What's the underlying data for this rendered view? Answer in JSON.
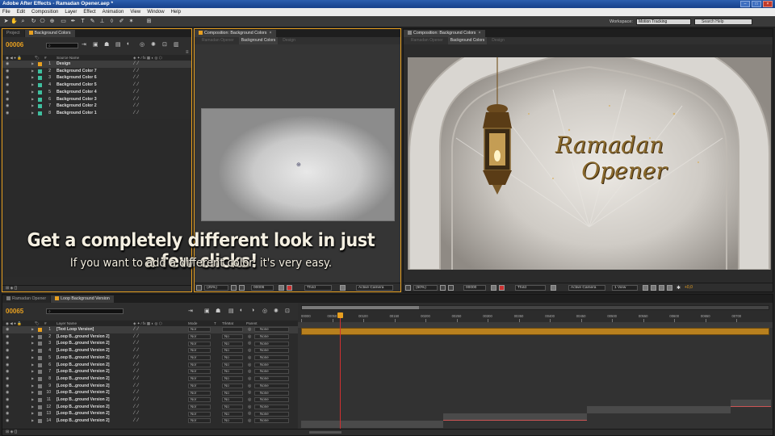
{
  "app": {
    "title": "Adobe After Effects - Ramadan Opener.aep *",
    "menu": [
      "File",
      "Edit",
      "Composition",
      "Layer",
      "Effect",
      "Animation",
      "View",
      "Window",
      "Help"
    ],
    "workspace_label": "Workspace:",
    "workspace_value": "Motion Tracking",
    "search_placeholder": "Search Help"
  },
  "left_panel": {
    "tabs": [
      "Project",
      "Background Colors"
    ],
    "timecode": "00006",
    "col_header": "Source Name",
    "layers": [
      {
        "idx": "1",
        "name": "Design",
        "color": "#e8a020"
      },
      {
        "idx": "2",
        "name": "Background Color 7",
        "color": "#3fbf9f"
      },
      {
        "idx": "3",
        "name": "Background Color 6",
        "color": "#3fbf9f"
      },
      {
        "idx": "4",
        "name": "Background Color 5",
        "color": "#3fbf9f"
      },
      {
        "idx": "5",
        "name": "Background Color 4",
        "color": "#3fbf9f"
      },
      {
        "idx": "6",
        "name": "Background Color 3",
        "color": "#3fbf9f"
      },
      {
        "idx": "7",
        "name": "Background Color 2",
        "color": "#3fbf9f"
      },
      {
        "idx": "8",
        "name": "Background Color 1",
        "color": "#3fbf9f"
      }
    ]
  },
  "center_panel": {
    "tab": "Composition: Background Colors",
    "subtabs": [
      "Ramadan Opener",
      "Background Colors",
      "Design"
    ],
    "zoom": "(25%)",
    "timecode": "00006",
    "resolution": "Third",
    "camera": "Active Camera"
  },
  "right_panel": {
    "tab": "Composition: Background Colors",
    "subtabs": [
      "Ramadan Opener",
      "Background Colors",
      "Design"
    ],
    "zoom": "(50%)",
    "timecode": "00000",
    "resolution": "Third",
    "camera": "Active Camera",
    "views": "1 View",
    "exposure": "+0,0",
    "logo_line1": "Ramadan",
    "logo_line2": "Opener"
  },
  "captions": {
    "main": "Get a completely different look in just a few clicks!",
    "sub": "If you want to add a different color, it's very easy."
  },
  "timeline": {
    "tabs": [
      "Ramadan Opener",
      "Loop Background Version"
    ],
    "timecode": "00065",
    "headers": {
      "layer_name": "Layer Name",
      "mode": "Mode",
      "t": "T",
      "trkmat": "TrkMat",
      "parent": "Parent"
    },
    "ruler": [
      "00000",
      "00050",
      "00100",
      "00150",
      "00200",
      "00250",
      "00300",
      "00350",
      "00400",
      "00450",
      "00500",
      "00550",
      "00600",
      "00650",
      "00700"
    ],
    "layers": [
      {
        "idx": "1",
        "name": "[Text Loop Version]",
        "color": "#e8a020",
        "mode": "Nor",
        "trkmat": "",
        "parent": "None"
      },
      {
        "idx": "2",
        "name": "[Loop B...ground Version 2]",
        "color": "#7a7a7a",
        "mode": "Nor",
        "trkmat": "No",
        "parent": "None"
      },
      {
        "idx": "3",
        "name": "[Loop B...ground Version 2]",
        "color": "#7a7a7a",
        "mode": "Nor",
        "trkmat": "No",
        "parent": "None"
      },
      {
        "idx": "4",
        "name": "[Loop B...ground Version 2]",
        "color": "#7a7a7a",
        "mode": "Nor",
        "trkmat": "No",
        "parent": "None"
      },
      {
        "idx": "5",
        "name": "[Loop B...ground Version 2]",
        "color": "#7a7a7a",
        "mode": "Nor",
        "trkmat": "No",
        "parent": "None"
      },
      {
        "idx": "6",
        "name": "[Loop B...ground Version 2]",
        "color": "#7a7a7a",
        "mode": "Nor",
        "trkmat": "No",
        "parent": "None"
      },
      {
        "idx": "7",
        "name": "[Loop B...ground Version 2]",
        "color": "#7a7a7a",
        "mode": "Nor",
        "trkmat": "No",
        "parent": "None"
      },
      {
        "idx": "8",
        "name": "[Loop B...ground Version 2]",
        "color": "#7a7a7a",
        "mode": "Nor",
        "trkmat": "No",
        "parent": "None"
      },
      {
        "idx": "9",
        "name": "[Loop B...ground Version 2]",
        "color": "#7a7a7a",
        "mode": "Nor",
        "trkmat": "No",
        "parent": "None"
      },
      {
        "idx": "10",
        "name": "[Loop B...ground Version 2]",
        "color": "#7a7a7a",
        "mode": "Nor",
        "trkmat": "No",
        "parent": "None"
      },
      {
        "idx": "11",
        "name": "[Loop B...ground Version 2]",
        "color": "#7a7a7a",
        "mode": "Nor",
        "trkmat": "No",
        "parent": "None"
      },
      {
        "idx": "12",
        "name": "[Loop B...ground Version 2]",
        "color": "#7a7a7a",
        "mode": "Nor",
        "trkmat": "No",
        "parent": "None"
      },
      {
        "idx": "13",
        "name": "[Loop B...ground Version 2]",
        "color": "#7a7a7a",
        "mode": "Nor",
        "trkmat": "No",
        "parent": "None"
      },
      {
        "idx": "14",
        "name": "[Loop B...ground Version 2]",
        "color": "#7a7a7a",
        "mode": "Nor",
        "trkmat": "No",
        "parent": "None"
      }
    ]
  },
  "colors": {
    "accent": "#e8a020",
    "timeline_bar": "#b8801e",
    "playhead": "#d03030"
  }
}
